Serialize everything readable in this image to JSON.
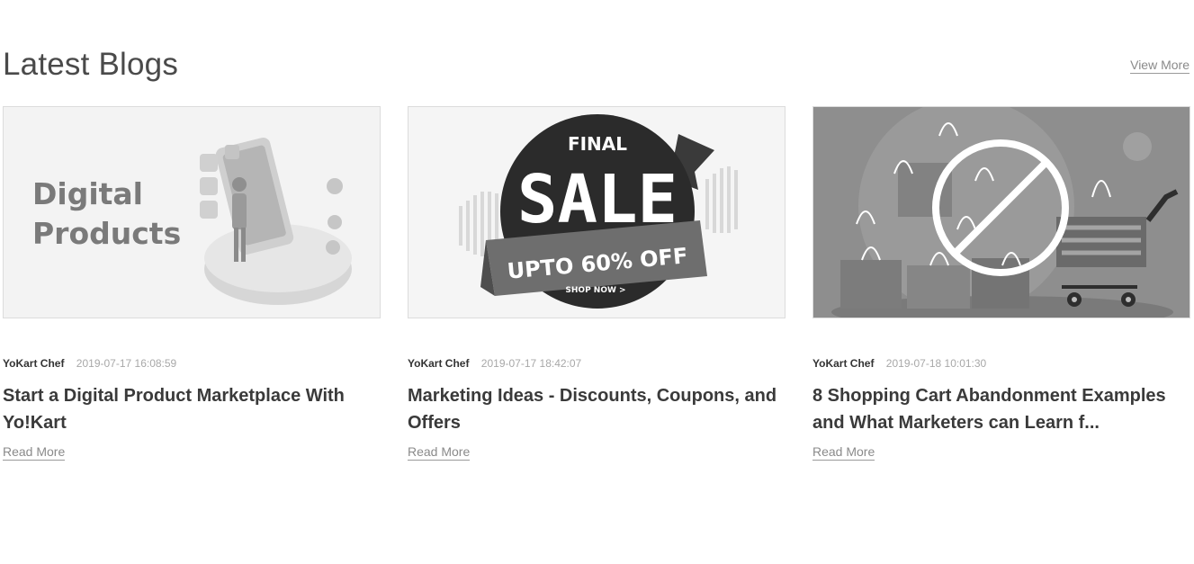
{
  "section": {
    "title": "Latest Blogs",
    "view_more": "View More"
  },
  "posts": [
    {
      "image_text": [
        "Digital",
        "Products"
      ],
      "author": "YoKart Chef",
      "date": "2019-07-17 16:08:59",
      "title": "Start a Digital Product Marketplace With Yo!Kart",
      "read_more": "Read More"
    },
    {
      "image_text": [
        "FINAL",
        "SALE",
        "UPTO 60% OFF",
        "SHOP NOW >"
      ],
      "author": "YoKart Chef",
      "date": "2019-07-17 18:42:07",
      "title": "Marketing Ideas - Discounts, Coupons, and Offers",
      "read_more": "Read More"
    },
    {
      "author": "YoKart Chef",
      "date": "2019-07-18 10:01:30",
      "title": "8 Shopping Cart Abandonment Examples and What Marketers can Learn f...",
      "read_more": "Read More"
    }
  ]
}
